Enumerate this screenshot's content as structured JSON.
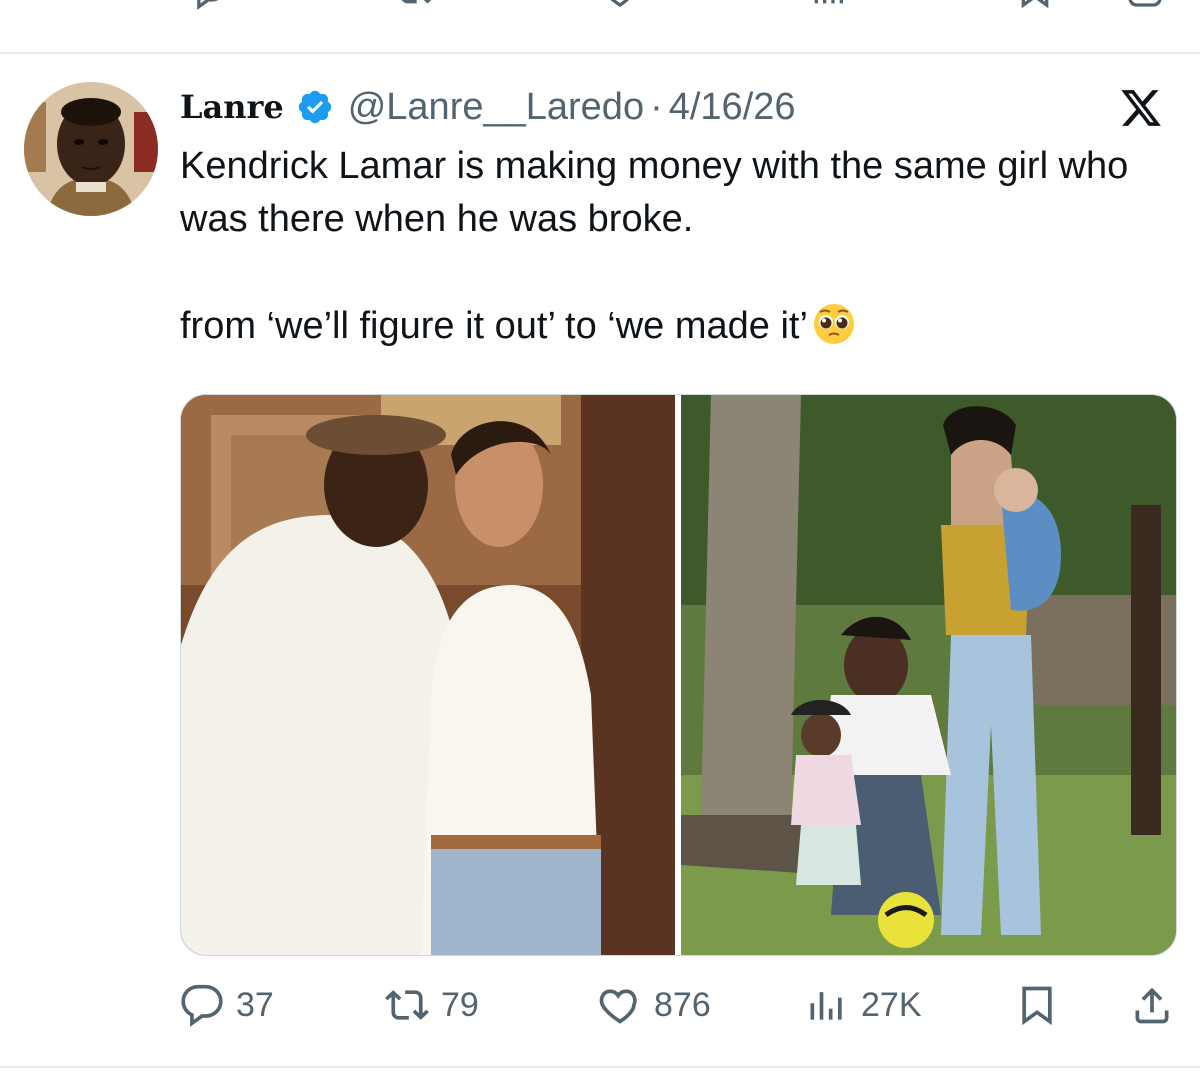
{
  "tweet": {
    "author": {
      "display_name": "Lanre",
      "handle": "@Lanre__Laredo",
      "separator": "·",
      "date": "4/16/26",
      "verified": true
    },
    "text_line1": "Kendrick Lamar is making money with the same girl who was there when he was broke.",
    "text_line2": "from ‘we’ll figure it out’ to ‘we made it’",
    "text_emoji": "pleading-face-emoji",
    "media": [
      {
        "alt": "then-photo",
        "description_icon": "photo"
      },
      {
        "alt": "now-photo",
        "description_icon": "photo"
      }
    ],
    "actions": {
      "replies": "37",
      "reposts": "79",
      "likes": "876",
      "views": "27K"
    }
  },
  "colors": {
    "text_primary": "#0f1419",
    "text_secondary": "#536471",
    "verified_blue": "#1d9bf0",
    "divider": "#e6ecf0"
  }
}
